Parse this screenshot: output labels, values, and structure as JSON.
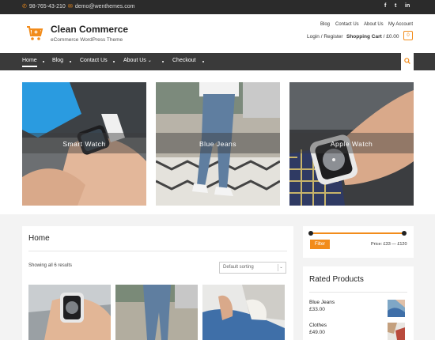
{
  "topbar": {
    "phone": "98-765-43-210",
    "email": "demo@wenthemes.com",
    "social": [
      "f",
      "t",
      "in"
    ],
    "social_icons": [
      "facebook-icon",
      "twitter-icon",
      "linkedin-icon"
    ]
  },
  "header": {
    "site_title": "Clean Commerce",
    "tagline": "eCommerce WordPress Theme",
    "links": [
      "Blog",
      "Contact Us",
      "About Us",
      "My Account"
    ],
    "login": "Login / Register",
    "cart_label": "Shopping Cart",
    "cart_total": "/ £0.00",
    "cart_count": "0"
  },
  "nav": {
    "items": [
      "Home",
      "Blog",
      "Contact Us",
      "About Us",
      "Checkout"
    ],
    "active": "Home",
    "dropdown_icon": "chevron-down-icon"
  },
  "banner": {
    "tiles": [
      "Smart Watch",
      "Blue Jeans",
      "Apple Watch"
    ]
  },
  "main": {
    "title": "Home",
    "results": "Showing all 6 results",
    "sort": "Default sorting"
  },
  "sidebar": {
    "filter_button": "Filter",
    "price_label": "Price: £33 — £120",
    "rated_title": "Rated Products",
    "rated": [
      {
        "name": "Blue Jeans",
        "price": "£33.00"
      },
      {
        "name": "Clothes",
        "price": "£49.00"
      }
    ]
  },
  "colors": {
    "accent": "#f28c1b",
    "nav": "#3a3a3a",
    "topbar": "#2b2b2b"
  }
}
